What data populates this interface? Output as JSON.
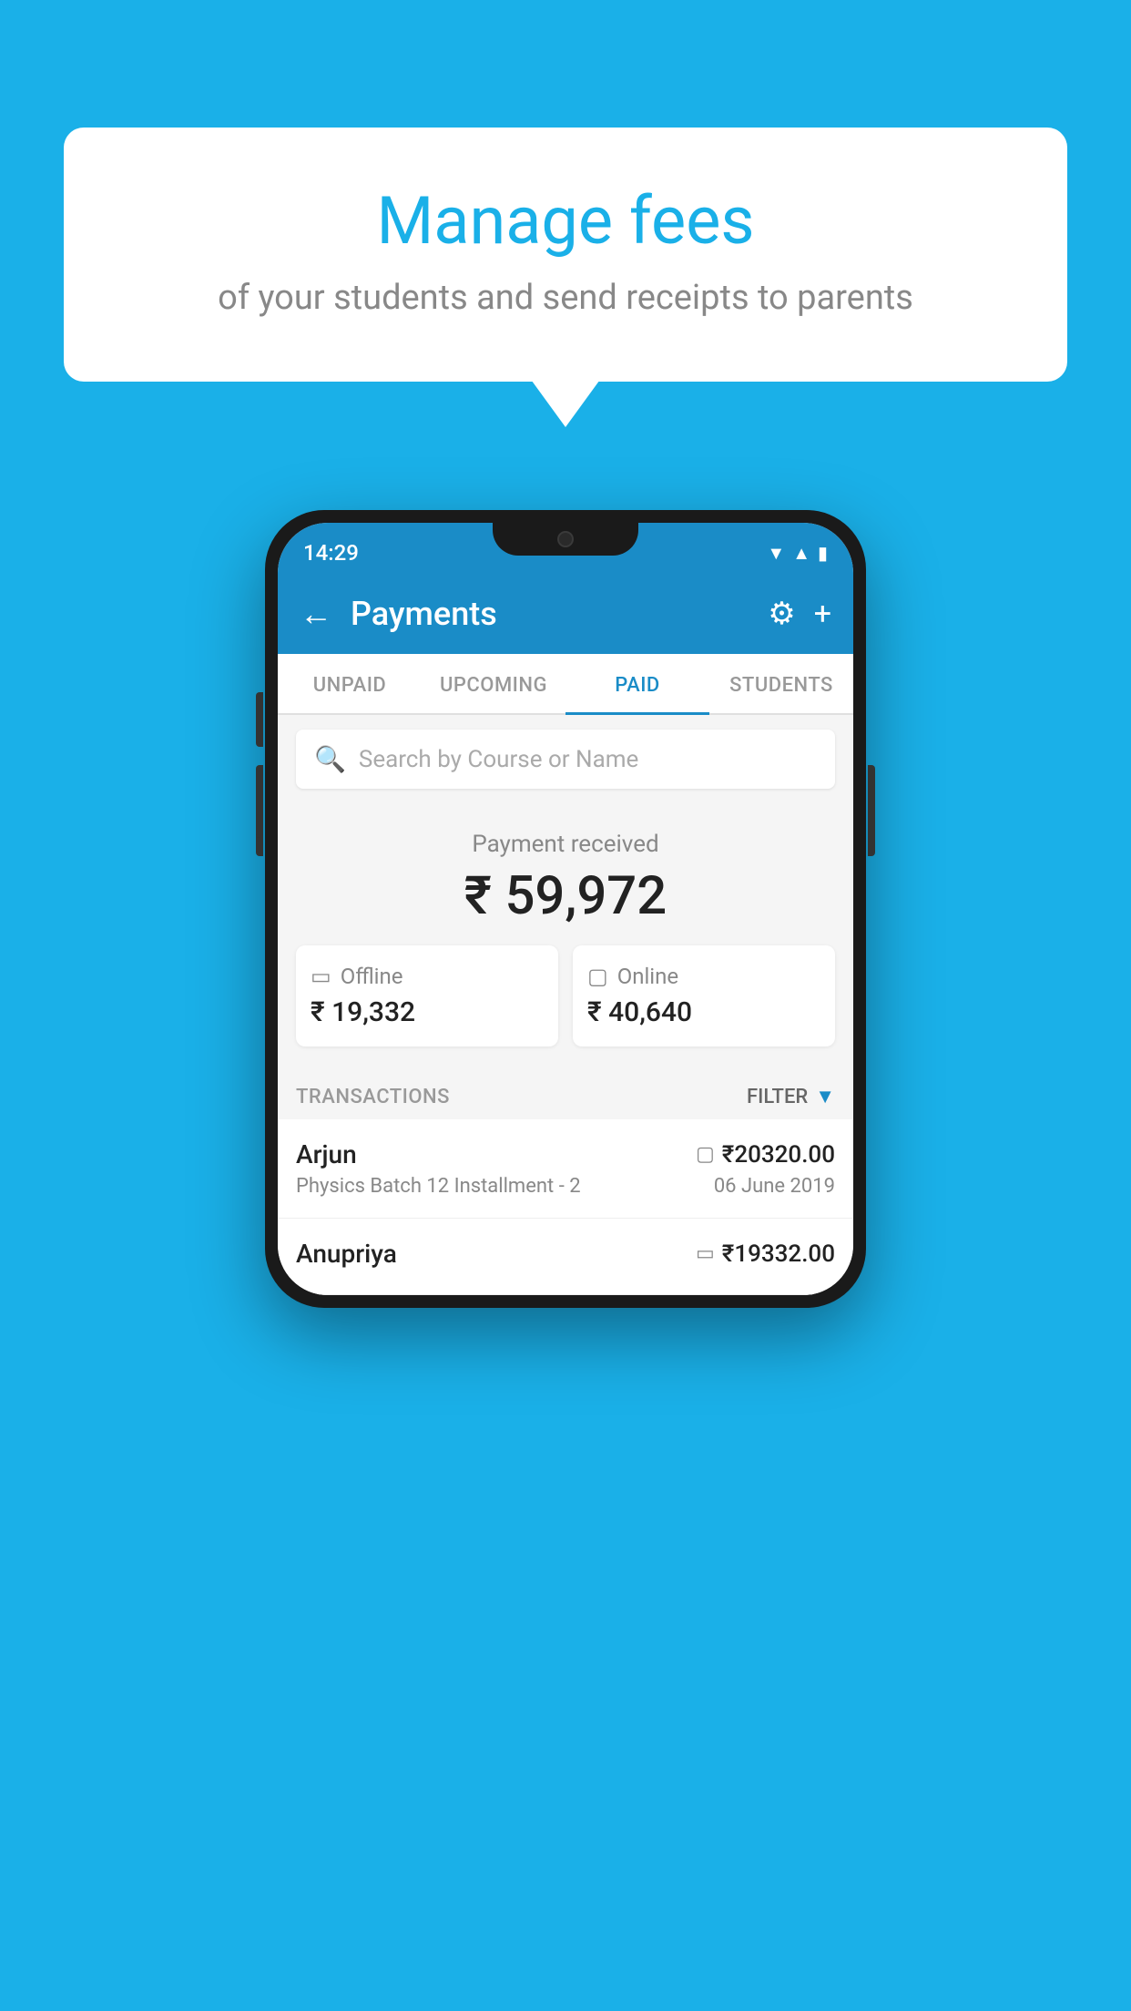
{
  "background": {
    "color": "#1ab0e8"
  },
  "speech_bubble": {
    "title": "Manage fees",
    "subtitle": "of your students and send receipts to parents"
  },
  "phone": {
    "status_bar": {
      "time": "14:29"
    },
    "app_bar": {
      "title": "Payments",
      "back_label": "←",
      "gear_label": "⚙",
      "plus_label": "+"
    },
    "tabs": [
      {
        "label": "UNPAID",
        "active": false
      },
      {
        "label": "UPCOMING",
        "active": false
      },
      {
        "label": "PAID",
        "active": true
      },
      {
        "label": "STUDENTS",
        "active": false
      }
    ],
    "search": {
      "placeholder": "Search by Course or Name"
    },
    "payment_summary": {
      "label": "Payment received",
      "total": "₹ 59,972",
      "offline_label": "Offline",
      "offline_amount": "₹ 19,332",
      "online_label": "Online",
      "online_amount": "₹ 40,640"
    },
    "transactions_section": {
      "label": "TRANSACTIONS",
      "filter_label": "FILTER"
    },
    "transactions": [
      {
        "name": "Arjun",
        "amount": "₹20320.00",
        "description": "Physics Batch 12 Installment - 2",
        "date": "06 June 2019",
        "payment_type": "online"
      },
      {
        "name": "Anupriya",
        "amount": "₹19332.00",
        "description": "",
        "date": "",
        "payment_type": "offline"
      }
    ]
  }
}
